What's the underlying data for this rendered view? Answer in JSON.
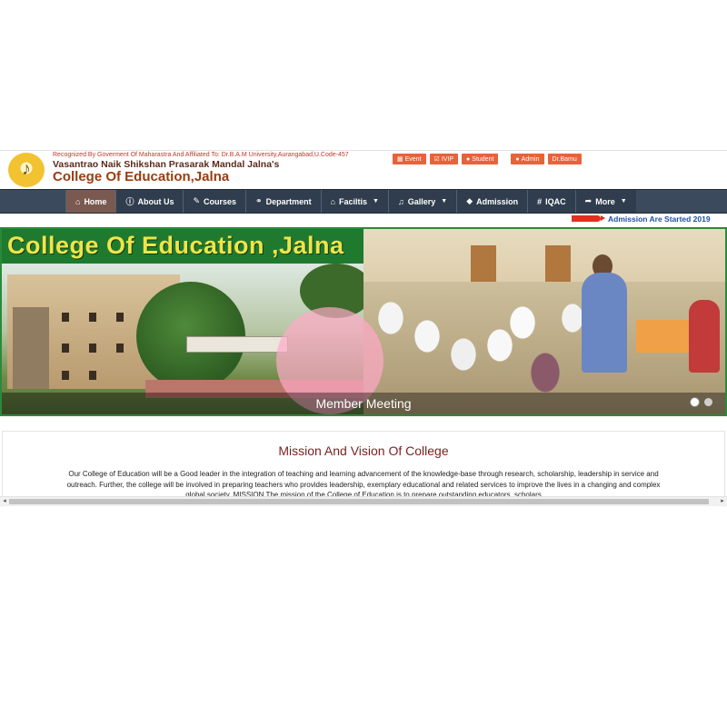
{
  "header": {
    "recognized": "Recognized By Goverment Of Maharastra And Affiliated To: Dr.B.A.M University,Aurangabad,U.Code-457",
    "org": "Vasantrao Naik Shikshan Prasarak Mandal Jalna's",
    "college": "College Of Education,Jalna",
    "top_links": [
      {
        "label": "Event",
        "icon": "calendar-icon"
      },
      {
        "label": "IVIP",
        "icon": "check-icon"
      },
      {
        "label": "Student",
        "icon": "user-icon"
      },
      {
        "label": "Admin",
        "icon": "user-icon"
      },
      {
        "label": "Dr.Bamu",
        "icon": ""
      }
    ]
  },
  "nav": {
    "items": [
      {
        "label": "Home",
        "icon": "home-icon",
        "active": true
      },
      {
        "label": "About Us",
        "icon": "info-icon"
      },
      {
        "label": "Courses",
        "icon": "edit-icon"
      },
      {
        "label": "Department",
        "icon": "handshake-icon"
      },
      {
        "label": "Faciltis",
        "icon": "bank-icon",
        "dropdown": true
      },
      {
        "label": "Gallery",
        "icon": "music-icon",
        "dropdown": true
      },
      {
        "label": "Admission",
        "icon": "graduation-cap-icon"
      },
      {
        "label": "IQAC",
        "icon": "hashtag-icon"
      },
      {
        "label": "More",
        "icon": "share-icon",
        "dropdown": true
      }
    ]
  },
  "ticker": {
    "badge": "new-badge",
    "text": "Admission Are Started 2019"
  },
  "slider": {
    "banner_title": "College Of Education ,Jalna",
    "caption": "Member Meeting",
    "slides": 2,
    "active_slide": 1
  },
  "content": {
    "title": "Mission And Vision Of College",
    "text": "Our College of Education will be a Good leader in the integration of teaching and learning advancement of the knowledge-base through research, scholarship, leadership in service and outreach. Further, the college will be involved in preparing teachers who provides leadership, exemplary educational and related services to improve the lives in a changing and complex global society. MISSION The mission of the College of Education is to prepare outstanding educators, scholars"
  },
  "colors": {
    "nav_bg": "#2f3d4e",
    "nav_active": "#7a5a50",
    "toplink_bg": "#e8623a",
    "title_brown": "#9a3c10",
    "banner_green": "#1f7a2f",
    "banner_yellow": "#f0e44a",
    "mission_title": "#7a1f1f"
  }
}
